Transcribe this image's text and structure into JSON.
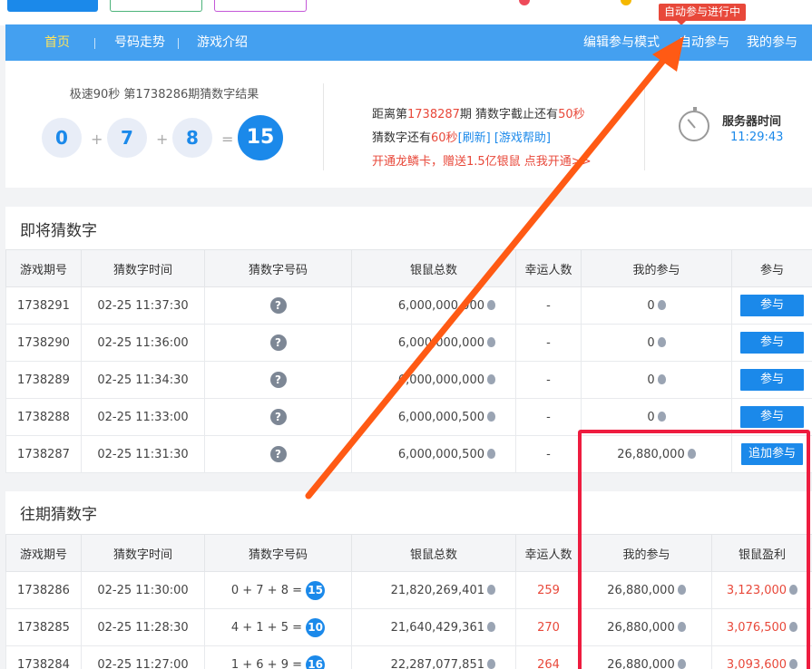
{
  "nav": {
    "items": [
      "首页",
      "号码走势",
      "游戏介绍"
    ],
    "right_items": [
      "编辑参与模式",
      "自动参与",
      "我的参与"
    ],
    "auto_badge": "自动参与进行中"
  },
  "result": {
    "title": "极速90秒 第1738286期猜数字结果",
    "numbers": [
      "0",
      "7",
      "8"
    ],
    "plus": "+",
    "equals": "=",
    "sum": "15"
  },
  "info": {
    "line1_a": "距离第",
    "line1_period": "1738287",
    "line1_b": "期 猜数字截止还有",
    "line1_secs": "50秒",
    "line2_a": "猜数字还有",
    "line2_secs": "60秒",
    "line2_refresh": "[刷新]",
    "line2_help": "[游戏帮助]",
    "line3": "开通龙鳞卡，赠送1.5亿银鼠 点我开通>>"
  },
  "server": {
    "label": "服务器时间",
    "time": "11:29:43"
  },
  "upcoming": {
    "title": "即将猜数字",
    "headers": [
      "游戏期号",
      "猜数字时间",
      "猜数字号码",
      "银鼠总数",
      "幸运人数",
      "我的参与",
      "参与"
    ],
    "rows": [
      {
        "period": "1738291",
        "time": "02-25 11:37:30",
        "code": "?",
        "total": "6,000,000,000",
        "lucky": "-",
        "mine": "0",
        "action": "参与"
      },
      {
        "period": "1738290",
        "time": "02-25 11:36:00",
        "code": "?",
        "total": "6,000,000,000",
        "lucky": "-",
        "mine": "0",
        "action": "参与"
      },
      {
        "period": "1738289",
        "time": "02-25 11:34:30",
        "code": "?",
        "total": "6,000,000,000",
        "lucky": "-",
        "mine": "0",
        "action": "参与"
      },
      {
        "period": "1738288",
        "time": "02-25 11:33:00",
        "code": "?",
        "total": "6,000,000,500",
        "lucky": "-",
        "mine": "0",
        "action": "参与"
      },
      {
        "period": "1738287",
        "time": "02-25 11:31:30",
        "code": "?",
        "total": "6,000,000,500",
        "lucky": "-",
        "mine": "26,880,000",
        "action": "追加参与"
      }
    ]
  },
  "past": {
    "title": "往期猜数字",
    "headers": [
      "游戏期号",
      "猜数字时间",
      "猜数字号码",
      "银鼠总数",
      "幸运人数",
      "我的参与",
      "银鼠盈利"
    ],
    "rows": [
      {
        "period": "1738286",
        "time": "02-25 11:30:00",
        "formula": "0 + 7 + 8 =",
        "sum": "15",
        "total": "21,820,269,401",
        "lucky": "259",
        "mine": "26,880,000",
        "profit": "3,123,000"
      },
      {
        "period": "1738285",
        "time": "02-25 11:28:30",
        "formula": "4 + 1 + 5 =",
        "sum": "10",
        "total": "21,640,429,361",
        "lucky": "270",
        "mine": "26,880,000",
        "profit": "3,076,500"
      },
      {
        "period": "1738284",
        "time": "02-25 11:27:00",
        "formula": "1 + 6 + 9 =",
        "sum": "16",
        "total": "22,287,077,851",
        "lucky": "264",
        "mine": "26,880,000",
        "profit": "3,093,600"
      }
    ]
  },
  "colors": {
    "nav": "#44a0f0",
    "accent": "#1b89ea",
    "annotation_red": "#ee1c3f",
    "arrow": "#ff5a14"
  }
}
